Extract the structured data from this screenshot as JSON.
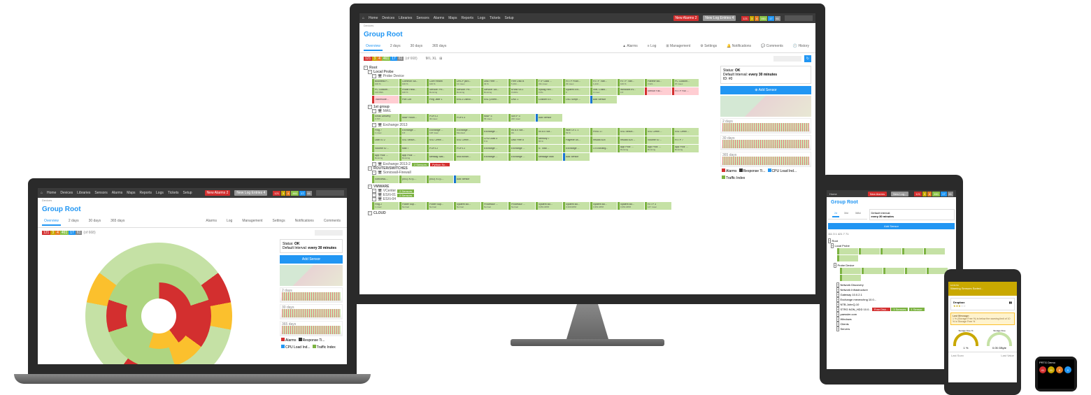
{
  "app": {
    "nav": [
      "Home",
      "Devices",
      "Libraries",
      "Sensors",
      "Alarms",
      "Maps",
      "Reports",
      "Logs",
      "Tickets",
      "Setup"
    ],
    "new_alarms_btn": "New Alarms 2",
    "new_log_btn": "New Log Entries 4",
    "status_badges": [
      {
        "cls": "sb-red",
        "val": "121"
      },
      {
        "cls": "sb-yel",
        "val": "3"
      },
      {
        "cls": "sb-ora",
        "val": "4"
      },
      {
        "cls": "sb-grn",
        "val": "461"
      },
      {
        "cls": "sb-blu",
        "val": "17"
      },
      {
        "cls": "sb-gry",
        "val": "61"
      }
    ],
    "search_placeholder": "Search..."
  },
  "page": {
    "title": "Group Root",
    "tabs": [
      "Overview",
      "2 days",
      "30 days",
      "365 days"
    ],
    "subtabs": [
      "Alarms",
      "Log",
      "Management",
      "Settings",
      "Notifications",
      "Comments",
      "History"
    ],
    "counts_bar": [
      {
        "cls": "sb-red",
        "val": "121"
      },
      {
        "cls": "sb-yel",
        "val": "3"
      },
      {
        "cls": "sb-ora",
        "val": "4"
      },
      {
        "cls": "sb-grn",
        "val": "461"
      },
      {
        "cls": "sb-blu",
        "val": "17"
      },
      {
        "cls": "sb-gry",
        "val": "61"
      },
      {
        "cls": "",
        "val": "(of 668)"
      }
    ],
    "size_lbl": "M   L   XL"
  },
  "side": {
    "status_lbl": "Status:",
    "status_val": "OK",
    "interval_lbl": "Default Interval:",
    "interval_val": "every 30 minutes",
    "id_lbl": "ID:",
    "id_val": "#0",
    "add_sensor": "Add Sensor",
    "charts": [
      "2 days",
      "30 days",
      "365 days"
    ],
    "legend": [
      {
        "c": "#d32f2f",
        "t": "Alarms"
      },
      {
        "c": "#333",
        "t": "Response Ti..."
      },
      {
        "c": "#2196f3",
        "t": "CPU Load Ind..."
      },
      {
        "c": "#7cb342",
        "t": "Traffic Index"
      }
    ]
  },
  "tree": {
    "root": "Root",
    "groups": [
      {
        "name": "Local Probe",
        "devices": [
          {
            "name": "Probe Device",
            "sensors": [
              {
                "n": "Business P...",
                "v": "100 %",
                "b": "grn"
              },
              {
                "n": "Common Sa...",
                "v": "100 %",
                "b": "grn"
              },
              {
                "n": "Core Health",
                "v": "100 %",
                "b": "grn"
              },
              {
                "n": "DHCP (Bro...",
                "v": "12 msec",
                "b": "grn"
              },
              {
                "n": "Disk Free: ...",
                "v": "32 %",
                "b": "grn"
              },
              {
                "n": "Free Disk B",
                "v": "5,164 ...",
                "b": "grn"
              },
              {
                "n": "FTP Data ...",
                "v": "311 msec",
                "b": "grn"
              },
              {
                "n": "HTTP Push...",
                "v": "29 msec",
                "b": "grn"
              },
              {
                "n": "HTTP Tran...",
                "v": "1,243 ...",
                "b": "grn"
              },
              {
                "n": "HTTP Tran...",
                "v": "100 %",
                "b": "grn"
              },
              {
                "n": "ParentFold...",
                "v": "3,321 ...",
                "b": "grn"
              },
              {
                "n": "PC Custom...",
                "v": "97 msec",
                "b": "grn"
              },
              {
                "n": "PC Custom...",
                "v": "110 KB/s",
                "b": "grn"
              },
              {
                "n": "Probe Heal...",
                "v": "100 %",
                "b": "grn"
              },
              {
                "n": "Service: PR...",
                "v": "Running",
                "b": "grn"
              },
              {
                "n": "Service: PR...",
                "v": "Running",
                "b": "grn"
              },
              {
                "n": "Service: UA...",
                "v": "Running",
                "b": "grn"
              },
              {
                "n": "sFlow V5.1",
                "v": "0 kbit/s",
                "b": "grn"
              },
              {
                "n": "Syslog Rec...",
                "v": "0 #/s",
                "b": "grn"
              },
              {
                "n": "System Ext...",
                "v": "0",
                "b": "grn"
              },
              {
                "n": "XML Custo...",
                "v": "0 msec",
                "b": "grn"
              },
              {
                "n": "Windows Ev...",
                "v": "0 #",
                "b": "grn"
              },
              {
                "n": "Sensor Fac...",
                "v": "",
                "b": "red",
                "s": "red"
              },
              {
                "n": "HTTP Full ...",
                "v": "",
                "b": "red",
                "s": "red"
              },
              {
                "n": "Traceroute...",
                "v": "",
                "b": "red",
                "s": "red"
              },
              {
                "n": "Port 139",
                "v": "",
                "b": "grn"
              },
              {
                "n": "Ping Jitter 1",
                "v": "",
                "b": "grn"
              },
              {
                "n": "ENC1 DBKill...",
                "v": "",
                "b": "grn"
              },
              {
                "n": "SSL (Overh...",
                "v": "",
                "b": "grn"
              },
              {
                "n": "DNS 1",
                "v": "",
                "b": "grn"
              },
              {
                "n": "Custom EX...",
                "v": "",
                "b": "grn"
              },
              {
                "n": "OS1 Script ...",
                "v": "",
                "b": "grn"
              },
              {
                "n": "Add Sensor",
                "v": "",
                "b": "blu",
                "add": true
              }
            ]
          }
        ]
      },
      {
        "name": "1st group",
        "devices": [
          {
            "name": "MAIL",
            "sensors": [
              {
                "n": "Email Delivery",
                "v": "3,737 ...",
                "b": "grn"
              },
              {
                "n": "IMAP Roun...",
                "v": "",
                "b": "grn"
              },
              {
                "n": "POP3 2",
                "v": "49 msec",
                "b": "grn"
              },
              {
                "n": "POP3 3",
                "v": "",
                "b": "grn"
              },
              {
                "n": "IMAP 3",
                "v": "55 msec",
                "b": "grn"
              },
              {
                "n": "SMTP 3",
                "v": "220 msec",
                "b": "grn"
              },
              {
                "n": "Add Sensor",
                "v": "",
                "b": "blu",
                "add": true
              }
            ]
          },
          {
            "name": "Exchange 2013",
            "sensors": [
              {
                "n": "Ping 7",
                "v": "1 msec",
                "b": "grn"
              },
              {
                "n": "Exchange ...",
                "v": "0 #",
                "b": "grn"
              },
              {
                "n": "Exchange ...",
                "v": "128 msec",
                "b": "grn"
              },
              {
                "n": "Exchange ...",
                "v": "Mounted",
                "b": "grn"
              },
              {
                "n": "Exchange ...",
                "v": "",
                "b": "grn"
              },
              {
                "n": "IIS 8.0 SM...",
                "v": "0/s",
                "b": "grn"
              },
              {
                "n": "IIS 8.0 SM...",
                "v": "",
                "b": "grn"
              },
              {
                "n": "WMI UTC 1",
                "v": "53 %",
                "b": "grn"
              },
              {
                "n": "PING 17",
                "v": "",
                "b": "grn"
              },
              {
                "n": "SSL Securi...",
                "v": "",
                "b": "grn"
              },
              {
                "n": "SSL Certifi ...",
                "v": "",
                "b": "grn"
              },
              {
                "n": "SSL Certifi ...",
                "v": "",
                "b": "grn"
              },
              {
                "n": "Diab IO 2",
                "v": "",
                "b": "grn"
              },
              {
                "n": "SSL Securi...",
                "v": "",
                "b": "grn"
              },
              {
                "n": "SSL Certifi ...",
                "v": "",
                "b": "grn"
              },
              {
                "n": "SSL Certifi ...",
                "v": "",
                "b": "grn"
              },
              {
                "n": "CPU Load 3",
                "v": "5 %",
                "b": "grn"
              },
              {
                "n": "Disk Free 8",
                "v": "",
                "b": "grn"
              },
              {
                "n": "Memory 7",
                "v": "65 %",
                "b": "grn"
              },
              {
                "n": "Pagefile Us...",
                "v": "",
                "b": "grn"
              },
              {
                "n": "hrsu86 825",
                "v": "",
                "b": "grn"
              },
              {
                "n": "hrsu86 825 ...",
                "v": "",
                "b": "grn"
              },
              {
                "n": "Volume IO ...",
                "v": "",
                "b": "grn"
              },
              {
                "n": "HTTP 7",
                "v": "",
                "b": "grn"
              },
              {
                "n": "Volume IO ...",
                "v": "",
                "b": "grn"
              },
              {
                "n": "Mail 7",
                "v": "",
                "b": "grn"
              },
              {
                "n": "POP3 2",
                "v": "",
                "b": "grn"
              },
              {
                "n": "POP3 2",
                "v": "",
                "b": "grn"
              },
              {
                "n": "Exchange ...",
                "v": "",
                "b": "grn"
              },
              {
                "n": "Exchange ...",
                "v": "",
                "b": "grn"
              },
              {
                "n": "S: Total ...",
                "v": "",
                "b": "grn"
              },
              {
                "n": "Exchange ...",
                "v": "",
                "b": "grn"
              },
              {
                "n": "OI Exchang...",
                "v": "",
                "b": "grn"
              },
              {
                "n": "App Pool: ...",
                "v": "Running",
                "b": "grn"
              },
              {
                "n": "App Pool: ...",
                "v": "Running",
                "b": "grn"
              },
              {
                "n": "App Pool: ...",
                "v": "Running",
                "b": "grn"
              },
              {
                "n": "App Pool: ...",
                "v": "Running",
                "b": "grn"
              },
              {
                "n": "App Pool: ...",
                "v": "Running",
                "b": "grn"
              },
              {
                "n": "Messag Stat...",
                "v": "",
                "b": "grn"
              },
              {
                "n": "MSExchan...",
                "v": "",
                "b": "grn"
              },
              {
                "n": "Exchange ...",
                "v": "",
                "b": "grn"
              },
              {
                "n": "Exchange ...",
                "v": "",
                "b": "grn"
              },
              {
                "n": "Message Mail",
                "v": "",
                "b": "grn"
              },
              {
                "n": "Add Sensor",
                "v": "",
                "b": "blu",
                "add": true
              }
            ]
          },
          {
            "name": "Exchange 2013-2",
            "badges": [
              {
                "c": "#7cb342",
                "t": "2 Sensors"
              },
              {
                "c": "#d32f2f",
                "t": "Python Sc..."
              }
            ]
          }
        ]
      },
      {
        "name": "ROUTER/SWITCHES",
        "devices": [
          {
            "name": "Sonicwall-Firewall",
            "sensors": [
              {
                "n": "SonicWAL...",
                "v": "",
                "b": "grn"
              },
              {
                "n": "(001) X0 (L...",
                "v": "",
                "b": "grn"
              },
              {
                "n": "(002) X1 (L...",
                "v": "",
                "b": "grn"
              },
              {
                "n": "Add Sensor",
                "v": "",
                "b": "blu",
                "add": true
              }
            ]
          }
        ]
      },
      {
        "name": "VMWARE",
        "devices": [
          {
            "name": "VCenter",
            "badges": [
              {
                "c": "#7cb342",
                "t": "2 Sensors"
              }
            ]
          },
          {
            "name": "ESXi-01",
            "badges": [
              {
                "c": "#7cb342",
                "t": "2 Sensors"
              }
            ]
          },
          {
            "name": "ESXi-04",
            "sensors": [
              {
                "n": "Ping 2",
                "v": "1 msec",
                "b": "grn"
              },
              {
                "n": "Power Sup...",
                "v": "Normal",
                "b": "grn"
              },
              {
                "n": "Power Sup...",
                "v": "Normal",
                "b": "grn"
              },
              {
                "n": "System Bo...",
                "v": "Normal",
                "b": "grn"
              },
              {
                "n": "Processor ...",
                "v": "Normal",
                "b": "grn"
              },
              {
                "n": "Processor ...",
                "v": "Normal",
                "b": "grn"
              },
              {
                "n": "System Bo...",
                "v": "3,351 RPM",
                "b": "grn"
              },
              {
                "n": "System Bo...",
                "v": "3,339 RPM",
                "b": "grn"
              },
              {
                "n": "System Bo...",
                "v": "3,351 RPM",
                "b": "grn"
              },
              {
                "n": "System Bo...",
                "v": "3,351 RPM",
                "b": "grn"
              },
              {
                "n": "HTTP 3",
                "v": "147 msec",
                "b": "grn"
              }
            ]
          }
        ]
      },
      {
        "name": "CLOUD",
        "devices": []
      }
    ]
  },
  "laptop": {
    "page_title": "Group Root",
    "tabs": [
      "Overview",
      "2 days",
      "30 days",
      "365 days"
    ],
    "subtabs": [
      "Alarms",
      "Log",
      "Management",
      "Settings",
      "Notifications",
      "Comments"
    ]
  },
  "tablet": {
    "title": "Group Root",
    "tabs": [
      "2d",
      "30d",
      "365d"
    ],
    "side_interval": "Default interval:",
    "side_interval_v": "every 30 minutes",
    "add_sensor": "Add Sensor",
    "counts": "111  3   1  421   7  71",
    "tree": [
      "Root",
      "Local Probe",
      "Probe Device",
      "Network Discovery",
      "Network Infrastructure",
      "Gateway 10.0.2.1",
      "Exchange mexexchng 10.0...",
      "NTB-JohnQ-10",
      "STRG NON_HDD 10.0...",
      "paessler.com",
      "Windows",
      "Clients",
      "Servers"
    ],
    "badges_free_disk": "Free Disk...",
    "badges_sensors": "3 Sensors",
    "badges_1sensor": "1 Sensor"
  },
  "phone": {
    "header": "Warning Sensors Sorted...",
    "card_title": "Dropbox",
    "rating": 3,
    "warn_title": "Last Message:",
    "warn_text": "1 % (Storage Free %) is below the warning limit of 10 % in Storage Free %",
    "gauges": [
      {
        "label": "Storage Free %",
        "val": "1 %",
        "warn": true
      },
      {
        "label": "Storage Free",
        "val": "0.05 GByte",
        "warn": false
      }
    ],
    "footer_l": "Last Scan",
    "footer_r": "Last Value"
  },
  "watch": {
    "title": "PRTG Demo",
    "dots": [
      {
        "c": "#d32f2f",
        "v": "41"
      },
      {
        "c": "#c9a800",
        "v": "11"
      },
      {
        "c": "#e67e22",
        "v": "8"
      },
      {
        "c": "#2196f3",
        "v": "0"
      }
    ]
  }
}
